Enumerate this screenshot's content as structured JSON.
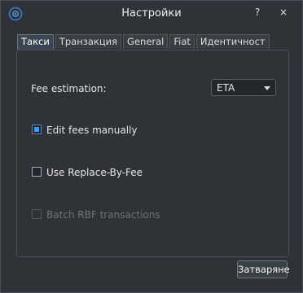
{
  "window": {
    "title": "Настройки",
    "help_label": "?",
    "close_label": "×"
  },
  "tabs": [
    {
      "label": "Такси",
      "active": true
    },
    {
      "label": "Транзакция"
    },
    {
      "label": "General"
    },
    {
      "label": "Fiat"
    },
    {
      "label": "Идентичност"
    }
  ],
  "fees": {
    "estimation_label": "Fee estimation:",
    "estimation_value": "ETA",
    "edit_manually_label": "Edit fees manually",
    "edit_manually_checked": true,
    "rbf_label": "Use Replace-By-Fee",
    "rbf_checked": false,
    "batch_rbf_label": "Batch RBF transactions",
    "batch_rbf_enabled": false
  },
  "footer": {
    "close_button_label": "Затваряне"
  },
  "colors": {
    "accent": "#3d9df3",
    "background": "#2f3236"
  },
  "icons": {
    "app": "electrum-logo-icon"
  }
}
